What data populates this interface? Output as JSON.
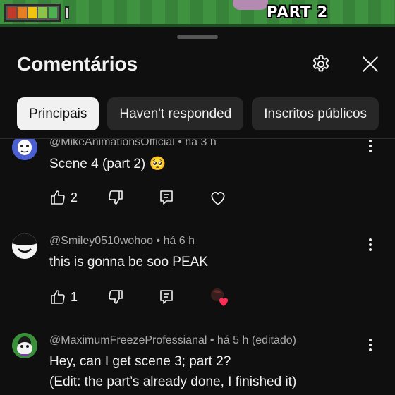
{
  "video": {
    "overlay_text": "PART 2",
    "battery_colors": [
      "#c0392b",
      "#e67e22",
      "#f1c40f",
      "#8bc34a",
      "#4caf50"
    ]
  },
  "sheet": {
    "title": "Comentários",
    "settings_icon": "gear-icon",
    "close_icon": "close-icon"
  },
  "chips": [
    {
      "label": "Principais",
      "active": true
    },
    {
      "label": "Haven't responded",
      "active": false
    },
    {
      "label": "Inscritos públicos",
      "active": false
    }
  ],
  "comments": [
    {
      "author": "@MikeAnimationsOfficial",
      "time": "há 3 h",
      "edited": "",
      "text_lines": [
        "Scene 4 (part 2) 🥺"
      ],
      "likes": "2",
      "creator_heart": false
    },
    {
      "author": "@Smiley0510wohoo",
      "time": "há 6 h",
      "edited": "",
      "text_lines": [
        "this is gonna be soo PEAK"
      ],
      "likes": "1",
      "creator_heart": true
    },
    {
      "author": "@MaximumFreezeProfessianal",
      "time": "há 5 h",
      "edited": "(editado)",
      "text_lines": [
        "Hey, can I get scene 3; part 2?",
        "(Edit: the part’s already done, I finished it)"
      ],
      "likes": "",
      "creator_heart": false
    }
  ],
  "colors": {
    "background": "#0f0f0f",
    "chip": "#272727",
    "chip_active": "#f1f1f1",
    "meta_text": "#aaaaaa",
    "heart": "#ff2d55"
  }
}
